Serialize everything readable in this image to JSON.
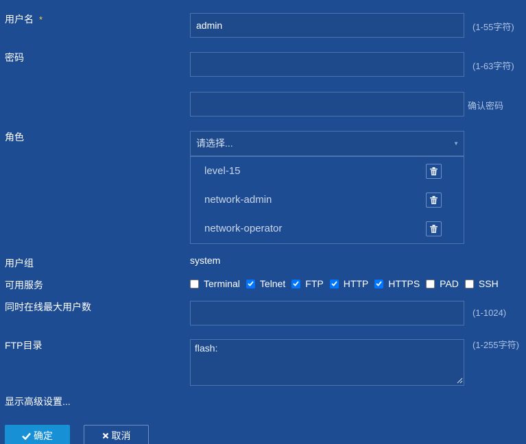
{
  "username": {
    "label": "用户名",
    "required_mark": "*",
    "value": "admin",
    "hint": "(1-55字符)"
  },
  "password": {
    "label": "密码",
    "value": "",
    "hint": "(1-63字符)",
    "confirm_value": "",
    "confirm_hint": "确认密码"
  },
  "role": {
    "label": "角色",
    "select_placeholder": "请选择...",
    "selected_roles": [
      "level-15",
      "network-admin",
      "network-operator"
    ]
  },
  "user_group": {
    "label": "用户组",
    "value": "system"
  },
  "services": {
    "label": "可用服务",
    "items": [
      {
        "name": "Terminal",
        "checked": false
      },
      {
        "name": "Telnet",
        "checked": true
      },
      {
        "name": "FTP",
        "checked": true
      },
      {
        "name": "HTTP",
        "checked": true
      },
      {
        "name": "HTTPS",
        "checked": true
      },
      {
        "name": "PAD",
        "checked": false
      },
      {
        "name": "SSH",
        "checked": false
      }
    ]
  },
  "max_online": {
    "label": "同时在线最大用户数",
    "value": "",
    "hint": "(1-1024)"
  },
  "ftp_dir": {
    "label": "FTP目录",
    "value": "flash:",
    "hint": "(1-255字符)"
  },
  "advanced_link": "显示高级设置...",
  "buttons": {
    "ok": "确定",
    "cancel": "取消"
  },
  "colors": {
    "background": "#1e4c93",
    "accent": "#1890d6",
    "required": "#f3d04a",
    "checkbox_checked": "#0075ff"
  }
}
